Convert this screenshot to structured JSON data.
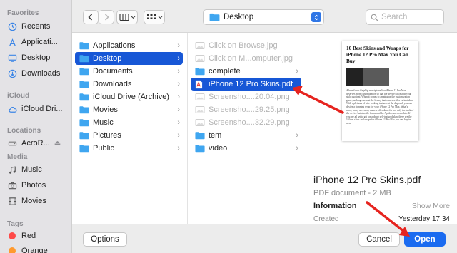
{
  "sidebar": {
    "favorites_header": "Favorites",
    "favorites": [
      {
        "label": "Recents",
        "icon": "clock-icon"
      },
      {
        "label": "Applicati...",
        "icon": "applications-icon"
      },
      {
        "label": "Desktop",
        "icon": "desktop-icon"
      },
      {
        "label": "Downloads",
        "icon": "download-icon"
      }
    ],
    "icloud_header": "iCloud",
    "icloud": [
      {
        "label": "iCloud Dri...",
        "icon": "cloud-icon"
      }
    ],
    "locations_header": "Locations",
    "locations": [
      {
        "label": "AcroR...",
        "icon": "disk-icon",
        "eject": "⏏"
      }
    ],
    "media_header": "Media",
    "media": [
      {
        "label": "Music",
        "icon": "music-icon"
      },
      {
        "label": "Photos",
        "icon": "camera-icon"
      },
      {
        "label": "Movies",
        "icon": "film-icon"
      }
    ],
    "tags_header": "Tags",
    "tags": [
      {
        "label": "Red",
        "color": "#fe4a49"
      },
      {
        "label": "Orange",
        "color": "#ff9a2e"
      }
    ]
  },
  "toolbar": {
    "back": "‹",
    "forward": "›",
    "location": "Desktop",
    "search_placeholder": "Search"
  },
  "column1": [
    {
      "label": "Applications",
      "selected": false
    },
    {
      "label": "Desktop",
      "selected": true
    },
    {
      "label": "Documents",
      "selected": false
    },
    {
      "label": "Downloads",
      "selected": false
    },
    {
      "label": "iCloud Drive (Archive)",
      "selected": false
    },
    {
      "label": "Movies",
      "selected": false
    },
    {
      "label": "Music",
      "selected": false
    },
    {
      "label": "Pictures",
      "selected": false
    },
    {
      "label": "Public",
      "selected": false
    }
  ],
  "column2": [
    {
      "label": "Click on Browse.jpg",
      "kind": "image",
      "dim": true
    },
    {
      "label": "Click on M...omputer.jpg",
      "kind": "image",
      "dim": true
    },
    {
      "label": "complete",
      "kind": "folder",
      "dim": false
    },
    {
      "label": "iPhone 12 Pro Skins.pdf",
      "kind": "pdf",
      "dim": false,
      "selected": true
    },
    {
      "label": "Screensho....20.04.png",
      "kind": "image",
      "dim": true
    },
    {
      "label": "Screensho....29.25.png",
      "kind": "image",
      "dim": true
    },
    {
      "label": "Screensho....32.29.png",
      "kind": "image",
      "dim": true
    },
    {
      "label": "tem",
      "kind": "folder",
      "dim": false
    },
    {
      "label": "video",
      "kind": "folder",
      "dim": false
    }
  ],
  "preview": {
    "doc_title": "10 Best Skins and Wraps for iPhone 12 Pro Max You Can Buy",
    "doc_body": "A brand new flagship smartphone like iPhone 12 Pro Max deserves more customization so that the device can match your style quotient. When it comes to amping up the customization game, nothing can beat the luxury that comes with a variant skin. With a plethora of nice-looking textures at the disposal, you can design a stunning wrap for your iPhone 12 Pro Max. What's more, many accessory makers offer skins for not only the back of the device but also the frame and the Apple camera module. If you are all set to get a matching self-textured skin, these are the 10 best skins and wraps for iPhone 12 Pro Max you can buy in now.",
    "name": "iPhone 12 Pro Skins.pdf",
    "kind": "PDF document - 2 MB",
    "info_label": "Information",
    "show_more": "Show More",
    "created_label": "Created",
    "created_value": "Yesterday 17:34"
  },
  "buttons": {
    "options": "Options",
    "cancel": "Cancel",
    "open": "Open"
  },
  "colors": {
    "selection": "#1757d6",
    "folder": "#3fa6f0",
    "accent": "#1a6bf0",
    "annotation_arrow": "#e6241f"
  }
}
